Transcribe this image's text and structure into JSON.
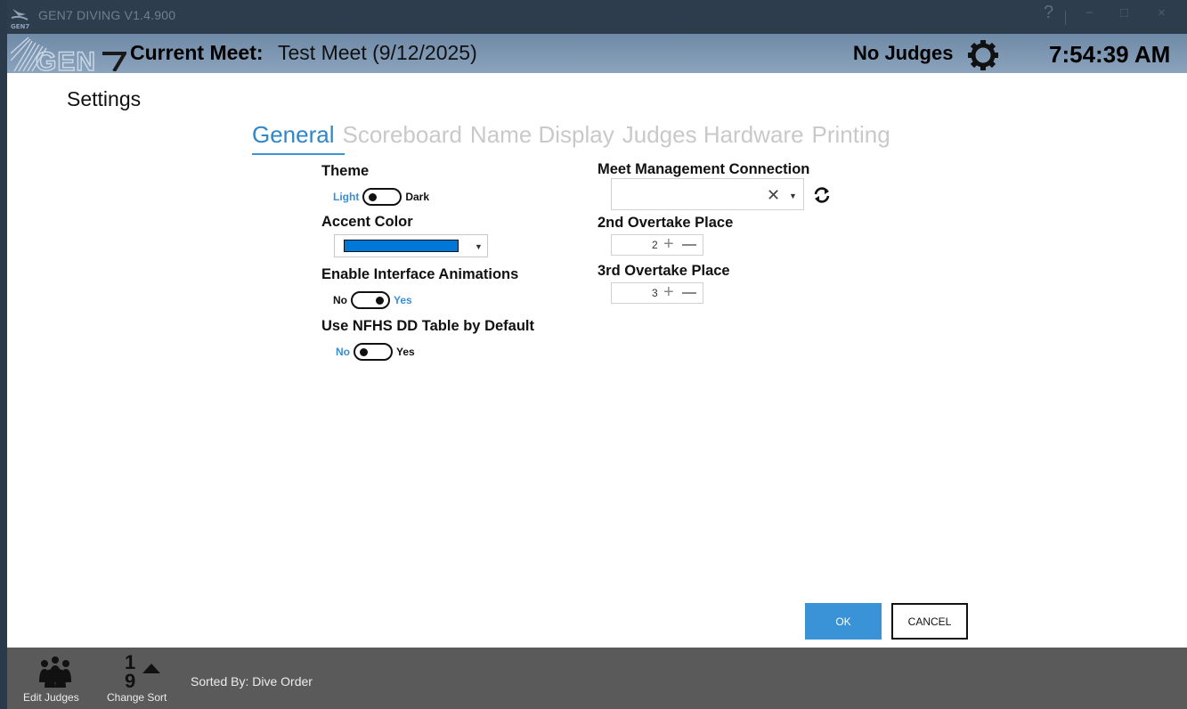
{
  "window": {
    "title": "GEN7 DIVING V1.4.900",
    "help": "?",
    "minimize": "−",
    "maximize": "□",
    "close": "×"
  },
  "header": {
    "meet_label": "Current Meet:",
    "meet_value": "Test Meet (9/12/2025)",
    "judges_status": "No Judges",
    "clock": "7:54:39 AM"
  },
  "page": {
    "title": "Settings"
  },
  "tabs": [
    {
      "label": "General",
      "active": true
    },
    {
      "label": "Scoreboard",
      "active": false
    },
    {
      "label": "Name Display",
      "active": false
    },
    {
      "label": "Judges Hardware",
      "active": false
    },
    {
      "label": "Printing",
      "active": false
    }
  ],
  "general": {
    "theme": {
      "label": "Theme",
      "left": "Light",
      "right": "Dark",
      "selected": "Light"
    },
    "accent": {
      "label": "Accent Color",
      "color": "#0078d7"
    },
    "animations": {
      "label": "Enable Interface Animations",
      "left": "No",
      "right": "Yes",
      "selected": "Yes"
    },
    "nfhs": {
      "label": "Use NFHS DD Table by Default",
      "left": "No",
      "right": "Yes",
      "selected": "No"
    },
    "connection": {
      "label": "Meet Management Connection",
      "value": ""
    },
    "overtake2": {
      "label": "2nd Overtake Place",
      "value": "2"
    },
    "overtake3": {
      "label": "3rd Overtake Place",
      "value": "3"
    }
  },
  "buttons": {
    "ok": "OK",
    "cancel": "CANCEL"
  },
  "footer": {
    "edit_judges": "Edit Judges",
    "change_sort": "Change Sort",
    "sort_top": "1",
    "sort_bottom": "9",
    "sorted_by": "Sorted By: Dive Order"
  },
  "colors": {
    "accent": "#3a93d6",
    "title_bar": "#2e3d4e",
    "header": "#7f98b2",
    "footer": "#5a5a5a"
  }
}
